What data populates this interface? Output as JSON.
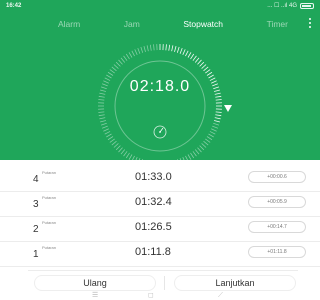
{
  "status_bar": {
    "time": "16:42",
    "right": "... ☐ ..ıl 4G"
  },
  "tabs": [
    {
      "label": "Alarm",
      "active": false
    },
    {
      "label": "Jam",
      "active": false
    },
    {
      "label": "Stopwatch",
      "active": true
    },
    {
      "label": "Timer",
      "active": false
    }
  ],
  "stopwatch": {
    "elapsed": "02:18.0",
    "dial_progress": 0.3
  },
  "laps": [
    {
      "index": "4",
      "label": "Putaran",
      "time": "01:33.0",
      "diff": "+00:00.6"
    },
    {
      "index": "3",
      "label": "Putaran",
      "time": "01:32.4",
      "diff": "+00:05.9"
    },
    {
      "index": "2",
      "label": "Putaran",
      "time": "01:26.5",
      "diff": "+00:14.7"
    },
    {
      "index": "1",
      "label": "Putaran",
      "time": "01:11.8",
      "diff": "+01:11.8"
    }
  ],
  "actions": {
    "reset_label": "Ulang",
    "resume_label": "Lanjutkan"
  },
  "colors": {
    "accent": "#1fa65a"
  },
  "icons": {
    "menu": "overflow-menu-icon",
    "nav_back": "back-icon",
    "nav_home": "home-icon",
    "nav_recent": "recent-apps-icon"
  }
}
